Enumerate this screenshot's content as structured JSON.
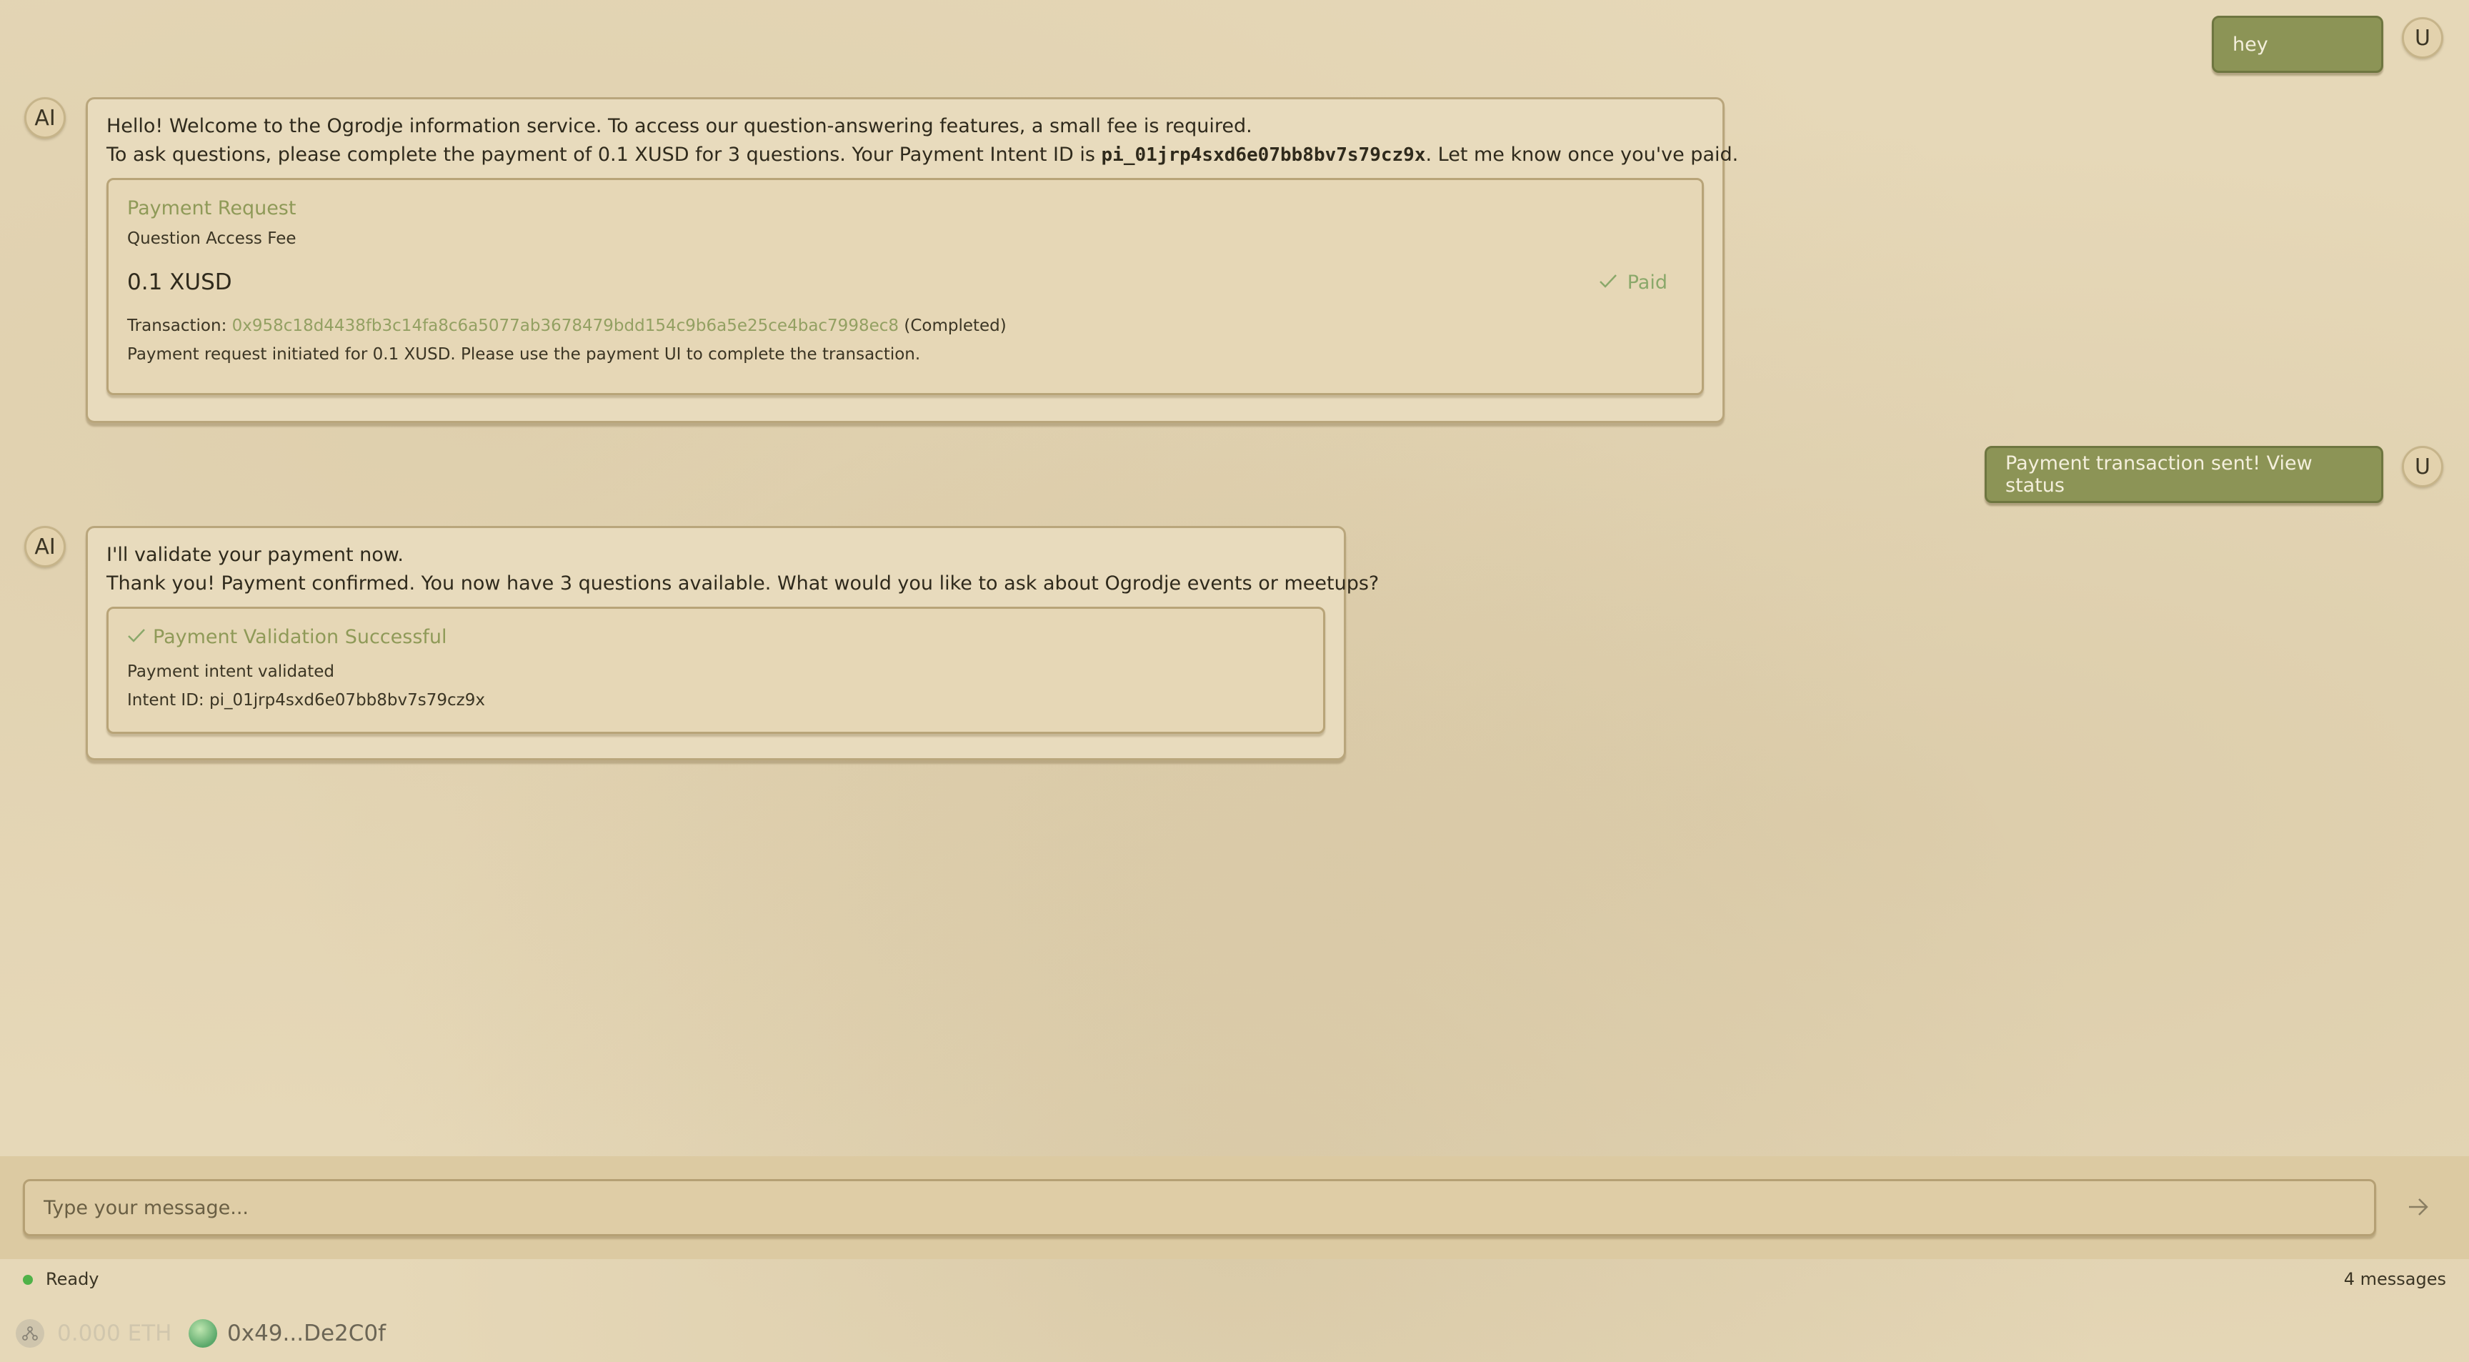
{
  "messages": {
    "user1": {
      "avatar": "U",
      "text": "hey"
    },
    "ai1": {
      "avatar": "AI",
      "line1": "Hello! Welcome to the Ogrodje information service. To access our question-answering features, a small fee is required.",
      "line2_before": "To ask questions, please complete the payment of 0.1 XUSD for 3 questions. Your Payment Intent ID is ",
      "line2_id": "pi_01jrp4sxd6e07bb8bv7s79cz9x",
      "line2_after": ". Let me know once you've paid.",
      "card": {
        "title": "Payment Request",
        "subtitle": "Question Access Fee",
        "amount": "0.1 XUSD",
        "status": "Paid",
        "status_icon": "check-icon",
        "tx_label": "Transaction: ",
        "tx_hash": "0x958c18d4438fb3c14fa8c6a5077ab3678479bdd154c9b6a5e25ce4bac7998ec8",
        "tx_status": " (Completed)",
        "note": "Payment request initiated for 0.1 XUSD. Please use the payment UI to complete the transaction."
      }
    },
    "user2": {
      "avatar": "U",
      "text": "Payment transaction sent! View status"
    },
    "ai2": {
      "avatar": "AI",
      "line1": "I'll validate your payment now.",
      "line2": "Thank you! Payment confirmed. You now have 3 questions available. What would you like to ask about Ogrodje events or meetups?",
      "card": {
        "title": "Payment Validation Successful",
        "line1": "Payment intent validated",
        "line2": "Intent ID: pi_01jrp4sxd6e07bb8bv7s79cz9x"
      }
    }
  },
  "composer": {
    "placeholder": "Type your message...",
    "send_icon": "arrow-right-icon"
  },
  "status": {
    "state": "Ready",
    "count": "4 messages"
  },
  "wallet": {
    "balance": "0.000 ETH",
    "address": "0x49...De2C0f"
  },
  "colors": {
    "user_bubble": "#8c9456",
    "accent_green": "#8f9a58",
    "status_ok": "#4fb248",
    "background": "#e6d8b8"
  }
}
